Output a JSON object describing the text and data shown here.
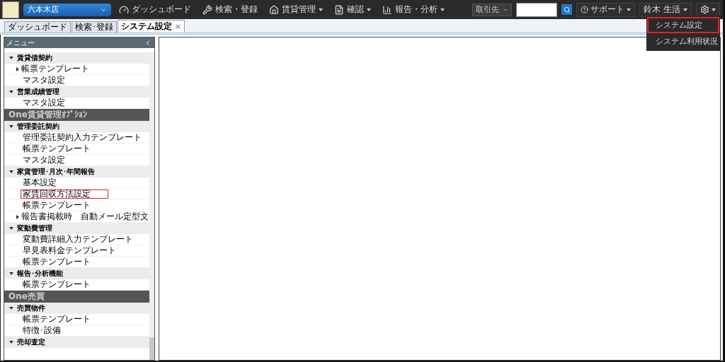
{
  "topbar": {
    "store_select": "六本木店",
    "nav": [
      {
        "kind": "dashboard",
        "label": "ダッシュボード",
        "dropdown": false
      },
      {
        "kind": "tools",
        "label": "検索・登録",
        "dropdown": false
      },
      {
        "kind": "home",
        "label": "賃貸管理",
        "dropdown": true
      },
      {
        "kind": "doc",
        "label": "確認",
        "dropdown": true
      },
      {
        "kind": "chart",
        "label": "報告・分析",
        "dropdown": true
      }
    ],
    "search_scope": "取引先",
    "support": "サポート",
    "user": "鈴木 生活"
  },
  "settings_menu": [
    {
      "label": "システム設定",
      "highlighted": true
    },
    {
      "label": "システム利用状況",
      "highlighted": false
    }
  ],
  "tabs": [
    {
      "label": "ダッシュボード",
      "selected": false,
      "closable": false
    },
    {
      "label": "検索･登録",
      "selected": false,
      "closable": false
    },
    {
      "label": "システム設定",
      "selected": true,
      "closable": true
    }
  ],
  "sidebar": {
    "title": "メニュー",
    "items": [
      {
        "kind": "group",
        "label": "賃貸借契約",
        "expanded": true,
        "children": [
          {
            "kind": "item",
            "label": "帳票テンプレート",
            "expanded": false,
            "highlighted": false
          },
          {
            "kind": "item",
            "label": "マスタ設定",
            "highlighted": false
          }
        ]
      },
      {
        "kind": "group",
        "label": "営業成績管理",
        "expanded": true,
        "children": [
          {
            "kind": "item",
            "label": "マスタ設定",
            "highlighted": false
          }
        ]
      },
      {
        "kind": "section",
        "label": "One賃貸管理ｵﾌﾟｼｮﾝ"
      },
      {
        "kind": "group",
        "label": "管理委託契約",
        "expanded": true,
        "children": [
          {
            "kind": "item",
            "label": "管理委託契約入力テンプレート",
            "highlighted": false
          },
          {
            "kind": "item",
            "label": "帳票テンプレート",
            "highlighted": false
          },
          {
            "kind": "item",
            "label": "マスタ設定",
            "highlighted": false
          }
        ]
      },
      {
        "kind": "group",
        "label": "家賃管理･月次･年間報告",
        "expanded": true,
        "children": [
          {
            "kind": "item",
            "label": "基本設定",
            "highlighted": false
          },
          {
            "kind": "item",
            "label": "家賃回収方法設定",
            "highlighted": true
          },
          {
            "kind": "item",
            "label": "帳票テンプレート",
            "highlighted": false
          },
          {
            "kind": "item",
            "label": "報告書掲載時　自動メール定型文",
            "expanded": false,
            "highlighted": false
          }
        ]
      },
      {
        "kind": "group",
        "label": "変動費管理",
        "expanded": true,
        "children": [
          {
            "kind": "item",
            "label": "変動費詳細入力テンプレート",
            "highlighted": false
          },
          {
            "kind": "item",
            "label": "早見表料金テンプレート",
            "highlighted": false
          },
          {
            "kind": "item",
            "label": "帳票テンプレート",
            "highlighted": false
          }
        ]
      },
      {
        "kind": "group",
        "label": "報告･分析機能",
        "expanded": true,
        "children": [
          {
            "kind": "item",
            "label": "帳票テンプレート",
            "highlighted": false
          }
        ]
      },
      {
        "kind": "section",
        "label": "One売買"
      },
      {
        "kind": "group",
        "label": "売買物件",
        "expanded": true,
        "children": [
          {
            "kind": "item",
            "label": "帳票テンプレート",
            "highlighted": false
          },
          {
            "kind": "item",
            "label": "特徴･設備",
            "highlighted": false
          }
        ]
      },
      {
        "kind": "group",
        "label": "売却査定",
        "expanded": true
      }
    ]
  }
}
